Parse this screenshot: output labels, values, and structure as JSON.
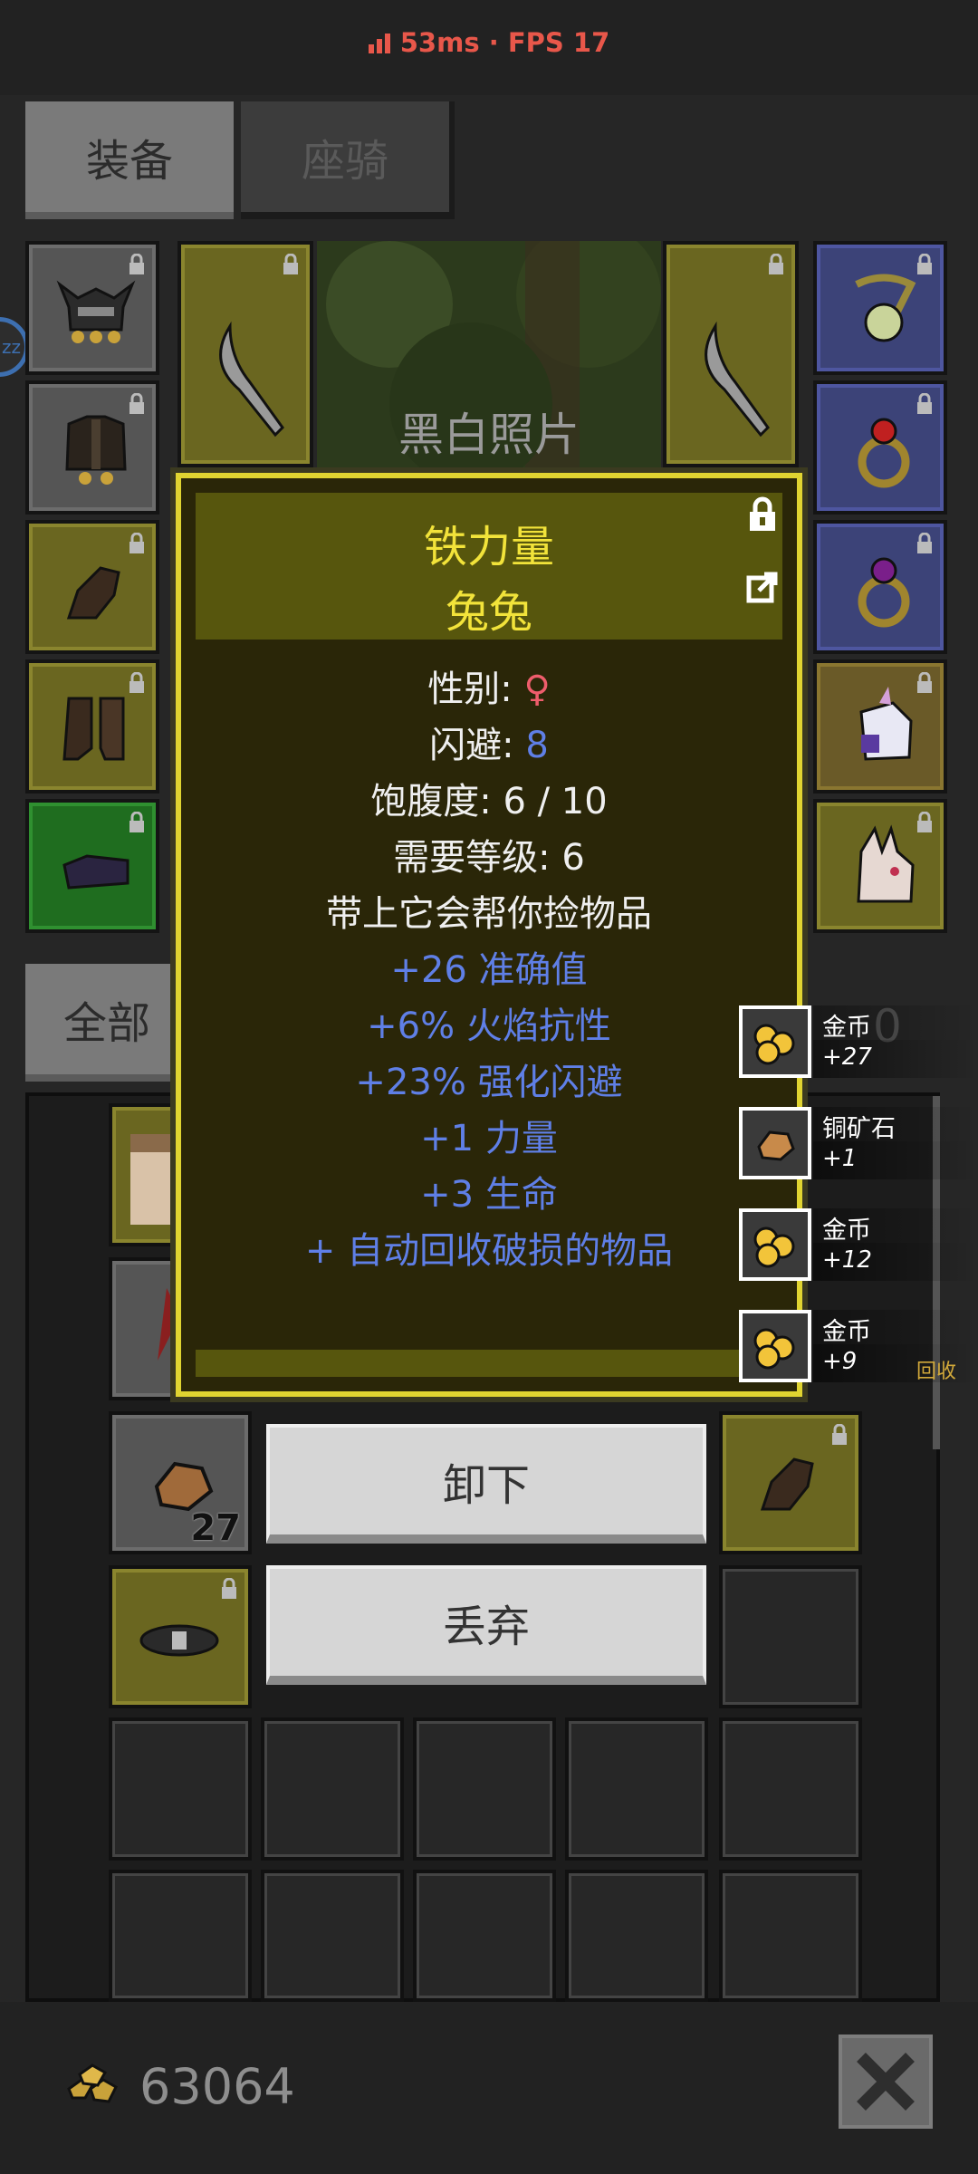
{
  "status": {
    "ping": "53ms",
    "separator": "·",
    "fps": "FPS 17"
  },
  "tabs": [
    {
      "label": "装备",
      "active": true
    },
    {
      "label": "座骑",
      "active": false
    }
  ],
  "portrait": {
    "caption": "黑白照片"
  },
  "side_bubble": {
    "text": "zz"
  },
  "filter": {
    "label": "全部"
  },
  "tooltip": {
    "name": "铁力量",
    "subtitle": "兔兔",
    "gender_label": "性别: ",
    "gender_value": "♀",
    "dodge_label": "闪避: ",
    "dodge_value": "8",
    "satiety": "饱腹度: 6 / 10",
    "level_req": "需要等级: 6",
    "description": "带上它会帮你捡物品",
    "bonuses": [
      "+26 准确值",
      "+6% 火焰抗性",
      "+23% 强化闪避",
      "+1 力量",
      "+3 生命",
      "+ 自动回收破损的物品"
    ]
  },
  "actions": {
    "unequip": "卸下",
    "discard": "丢弃"
  },
  "pickup_log": [
    {
      "name": "金币",
      "qty": "+27",
      "icon": "gold-coins-icon"
    },
    {
      "name": "铜矿石",
      "qty": "+1",
      "icon": "copper-ore-icon"
    },
    {
      "name": "金币",
      "qty": "+12",
      "icon": "gold-coins-icon"
    },
    {
      "name": "金币",
      "qty": "+9",
      "icon": "gold-coins-icon"
    }
  ],
  "pickup_extra": {
    "recycle": "回收",
    "partial_digit": "0"
  },
  "inventory": {
    "ore_count": "27"
  },
  "wallet": {
    "coins": "63064"
  },
  "colors": {
    "accent_yellow": "#e0d431",
    "bonus_blue": "#5f7fe6",
    "ping_red": "#e8574a"
  }
}
